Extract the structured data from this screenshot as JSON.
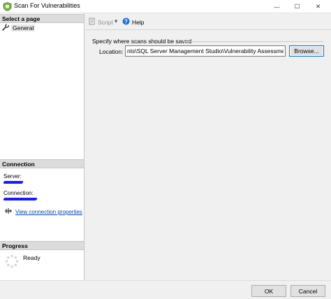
{
  "window": {
    "title": "Scan For Vulnerabilities",
    "minimize": "—",
    "maximize": "☐",
    "close": "✕"
  },
  "left_pane": {
    "select_page_header": "Select a page",
    "pages": [
      {
        "label": "General",
        "icon": "wrench-icon"
      }
    ],
    "connection_header": "Connection",
    "server_label": "Server:",
    "server_value": "",
    "connection_label": "Connection:",
    "connection_value": "",
    "view_connection_link": "View connection properties",
    "progress_header": "Progress",
    "progress_status": "Ready"
  },
  "toolbar": {
    "script_label": "Script",
    "script_dropdown": "▾",
    "help_label": "Help"
  },
  "main": {
    "group_label": "Specify where scans should be saved",
    "location_label": "Location:",
    "location_value": "nts\\SQL Server Management Studio\\Vulnerability Assessment Reports",
    "browse_label": "Browse..."
  },
  "footer": {
    "ok_label": "OK",
    "cancel_label": "Cancel"
  },
  "colors": {
    "link": "#0645ad",
    "focus_border": "#0078d7",
    "redaction": "#1a1aff"
  }
}
